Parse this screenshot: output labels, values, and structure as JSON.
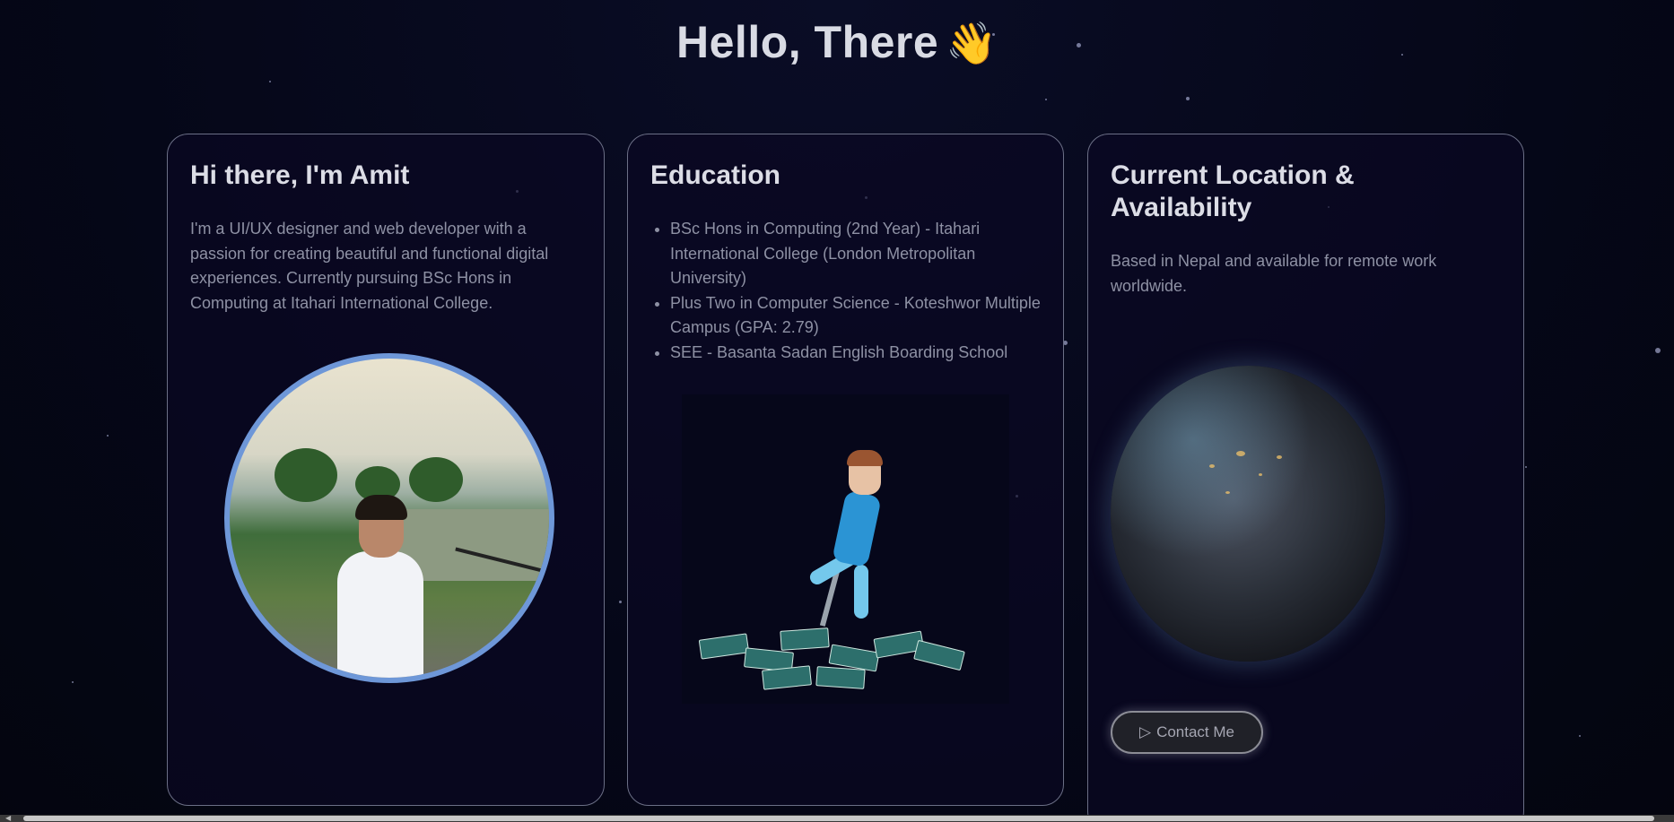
{
  "headline": {
    "text": "Hello, There",
    "emoji": "👋"
  },
  "about": {
    "title": "Hi there, I'm Amit",
    "body": "I'm a UI/UX designer and web developer with a passion for creating beautiful and functional digital experiences. Currently pursuing BSc Hons in Computing at Itahari International College."
  },
  "education": {
    "title": "Education",
    "items": [
      "BSc Hons in Computing (2nd Year) - Itahari International College (London Metropolitan University)",
      "Plus Two in Computer Science - Koteshwor Multiple Campus (GPA: 2.79)",
      "SEE - Basanta Sadan English Boarding School"
    ]
  },
  "location": {
    "title": "Current Location & Availability",
    "body": "Based in Nepal and available for remote work worldwide.",
    "contact_label": "Contact Me",
    "contact_icon": "send-icon"
  },
  "colors": {
    "background": "#050718",
    "card_border": "#6b6f86",
    "avatar_ring": "#6e97d8",
    "heading": "#dcdde6",
    "body_text": "#8e91a4"
  }
}
